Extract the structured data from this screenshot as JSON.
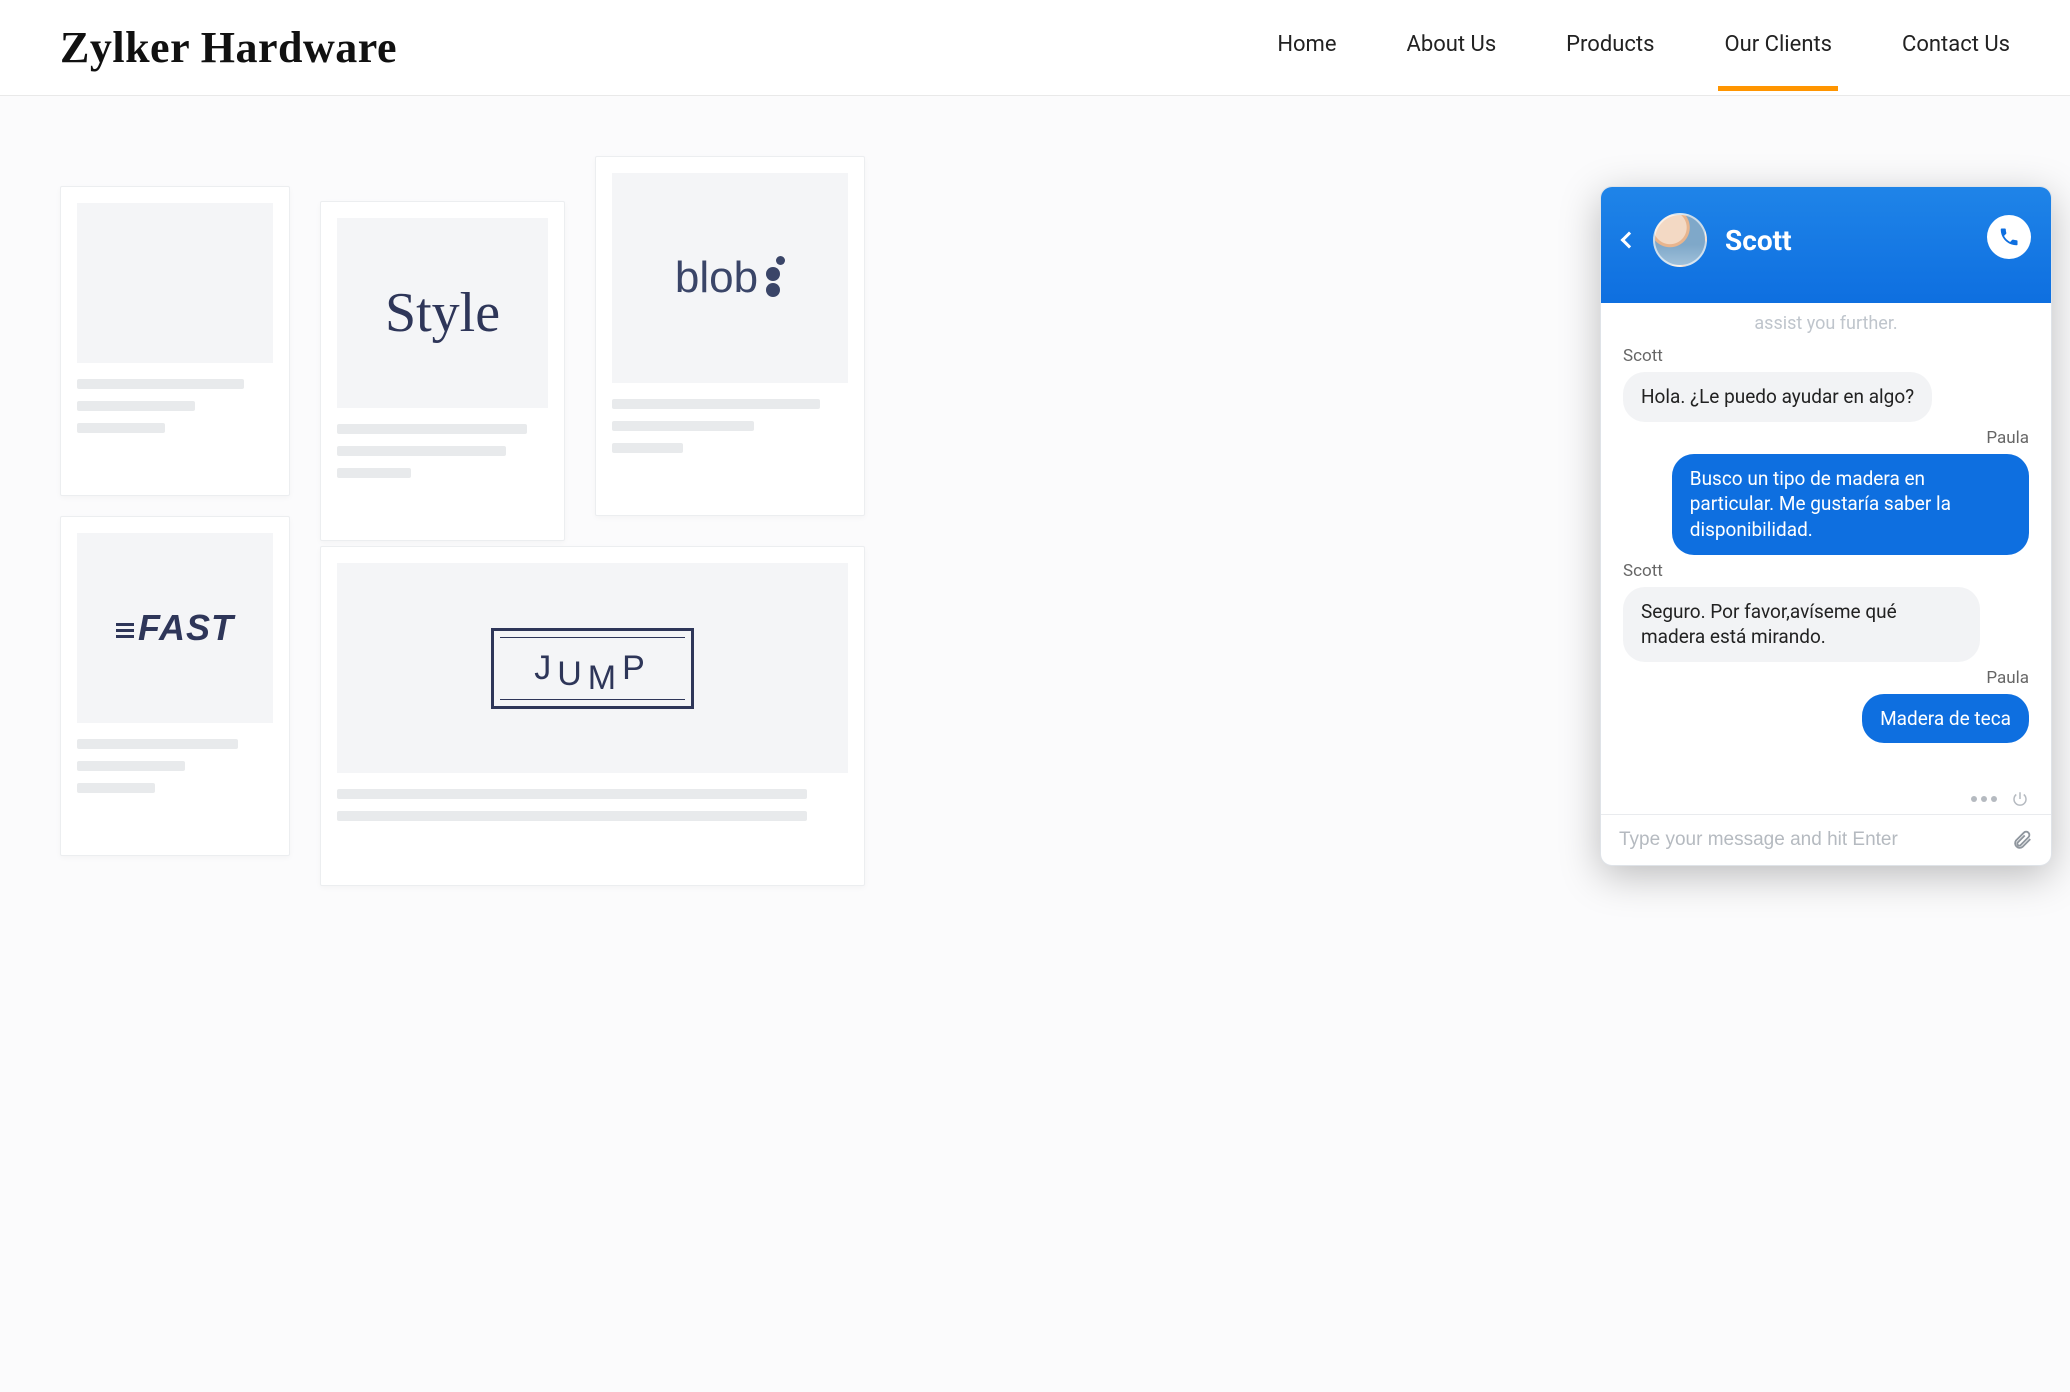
{
  "brand": "Zylker Hardware",
  "nav": {
    "items": [
      {
        "label": "Home"
      },
      {
        "label": "About Us"
      },
      {
        "label": "Products"
      },
      {
        "label": "Our Clients"
      },
      {
        "label": "Contact Us"
      }
    ],
    "active_index": 3
  },
  "clients": {
    "logos": {
      "style": "Style",
      "blob": "blob",
      "fast": "FAST",
      "jump": "JUMP"
    }
  },
  "chat": {
    "agent_name": "Scott",
    "truncated_previous": "assist you further.",
    "messages": [
      {
        "from": "agent",
        "sender": "Scott",
        "text": "Hola. ¿Le puedo ayudar en algo?"
      },
      {
        "from": "user",
        "sender": "Paula",
        "text": "Busco un tipo de madera en particular. Me gustaría saber la disponibilidad."
      },
      {
        "from": "agent",
        "sender": "Scott",
        "text": "Seguro. Por favor,avíseme qué madera está mirando."
      },
      {
        "from": "user",
        "sender": "Paula",
        "text": "Madera de teca"
      }
    ],
    "input_placeholder": "Type your message and hit Enter"
  },
  "colors": {
    "accent_orange": "#ff9500",
    "chat_blue": "#0e6fe0"
  }
}
